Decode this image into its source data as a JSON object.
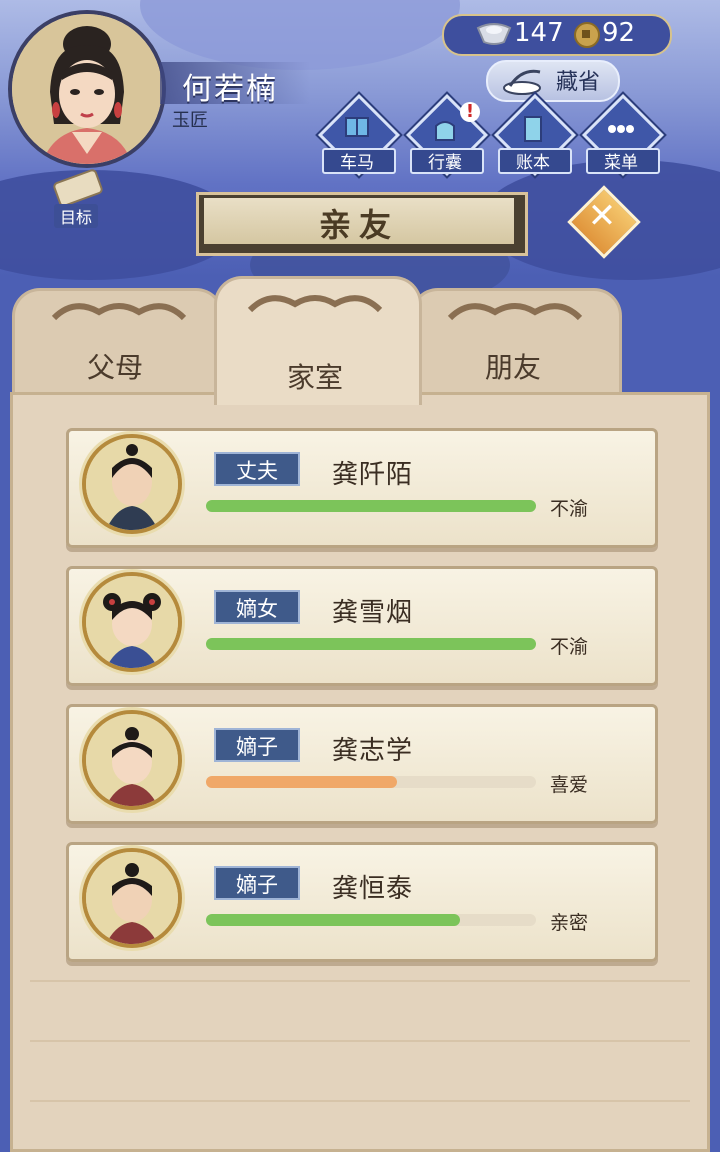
{
  "player": {
    "name": "何若楠",
    "title": "玉匠"
  },
  "currency": {
    "silver": "147",
    "gold": "92"
  },
  "collection_button": {
    "label": "藏省"
  },
  "menu": [
    {
      "label": "车马",
      "icon": "carriage-icon",
      "alert": false
    },
    {
      "label": "行囊",
      "icon": "bag-icon",
      "alert": true
    },
    {
      "label": "账本",
      "icon": "ledger-icon",
      "alert": false
    },
    {
      "label": "菜单",
      "icon": "more-icon",
      "alert": false
    }
  ],
  "goal_button": {
    "label": "目标"
  },
  "panel_title": "亲友",
  "tabs": [
    {
      "label": "父母",
      "active": false
    },
    {
      "label": "家室",
      "active": true
    },
    {
      "label": "朋友",
      "active": false
    }
  ],
  "members": [
    {
      "relation": "丈夫",
      "name": "龚阡陌",
      "mood": "不渝",
      "affection": 1.0,
      "bar_color": "#7cc45a"
    },
    {
      "relation": "嫡女",
      "name": "龚雪烟",
      "mood": "不渝",
      "affection": 1.0,
      "bar_color": "#7cc45a"
    },
    {
      "relation": "嫡子",
      "name": "龚志学",
      "mood": "喜爱",
      "affection": 0.58,
      "bar_color": "#f0a868"
    },
    {
      "relation": "嫡子",
      "name": "龚恒泰",
      "mood": "亲密",
      "affection": 0.77,
      "bar_color": "#7cc45a"
    }
  ]
}
